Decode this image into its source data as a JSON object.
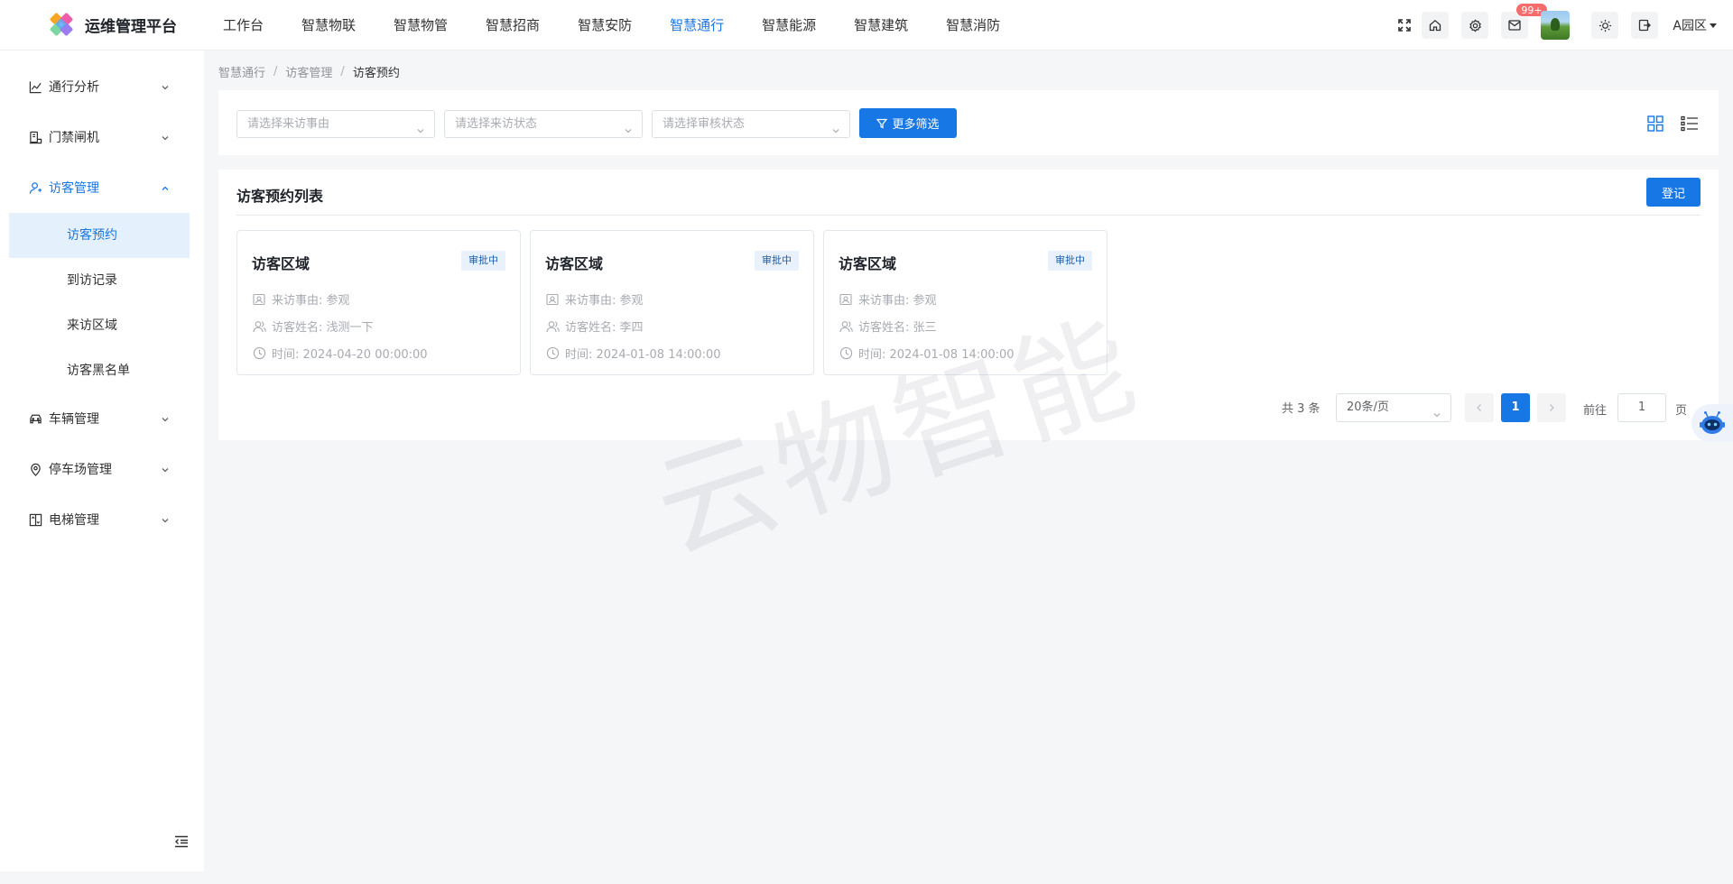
{
  "app": {
    "title": "运维管理平台"
  },
  "topnav": {
    "items": [
      {
        "label": "工作台",
        "active": false
      },
      {
        "label": "智慧物联",
        "active": false
      },
      {
        "label": "智慧物管",
        "active": false
      },
      {
        "label": "智慧招商",
        "active": false
      },
      {
        "label": "智慧安防",
        "active": false
      },
      {
        "label": "智慧通行",
        "active": true
      },
      {
        "label": "智慧能源",
        "active": false
      },
      {
        "label": "智慧建筑",
        "active": false
      },
      {
        "label": "智慧消防",
        "active": false
      }
    ]
  },
  "toolbar": {
    "mail_badge": "99+",
    "area": "A园区"
  },
  "sidebar": {
    "items": [
      {
        "label": "通行分析",
        "icon": "chart-line-icon"
      },
      {
        "label": "门禁闸机",
        "icon": "gate-icon"
      },
      {
        "label": "访客管理",
        "icon": "user-icon",
        "open": true
      },
      {
        "label": "车辆管理",
        "icon": "car-icon"
      },
      {
        "label": "停车场管理",
        "icon": "location-pin-icon"
      },
      {
        "label": "电梯管理",
        "icon": "elevator-icon"
      }
    ],
    "submenu": [
      {
        "label": "访客预约",
        "active": true
      },
      {
        "label": "到访记录",
        "active": false
      },
      {
        "label": "来访区域",
        "active": false
      },
      {
        "label": "访客黑名单",
        "active": false
      }
    ]
  },
  "breadcrumb": [
    "智慧通行",
    "访客管理",
    "访客预约"
  ],
  "filters": {
    "reason_placeholder": "请选择来访事由",
    "status_placeholder": "请选择来访状态",
    "review_placeholder": "请选择审核状态",
    "more_label": "更多筛选"
  },
  "list": {
    "title": "访客预约列表",
    "register_label": "登记",
    "cards": [
      {
        "title": "访客区域",
        "tag": "审批中",
        "reason": "来访事由: 参观",
        "name": "访客姓名: 浅测一下",
        "time": "时间: 2024-04-20 00:00:00"
      },
      {
        "title": "访客区域",
        "tag": "审批中",
        "reason": "来访事由: 参观",
        "name": "访客姓名: 李四",
        "time": "时间: 2024-01-08 14:00:00"
      },
      {
        "title": "访客区域",
        "tag": "审批中",
        "reason": "来访事由: 参观",
        "name": "访客姓名: 张三",
        "time": "时间: 2024-01-08 14:00:00"
      }
    ]
  },
  "pagination": {
    "total": "共 3 条",
    "page_size": "20条/页",
    "current_page": "1",
    "goto_label": "前往",
    "goto_value": "1",
    "page_suffix": "页"
  },
  "watermark": "云物智能",
  "colors": {
    "primary": "#1677e5",
    "badge": "#f56c6c",
    "active_bg": "#e5f0fd"
  }
}
